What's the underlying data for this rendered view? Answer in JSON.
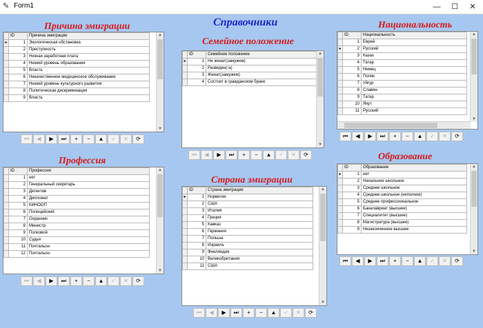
{
  "window": {
    "title": "Form1",
    "minimize": "—",
    "maximize": "☐",
    "close": "✕"
  },
  "headings": {
    "main": "Справочники",
    "reasons": "Причина эмиграции",
    "family": "Семейное положение",
    "nationality": "Национальность",
    "profession": "Профессия",
    "countries": "Страна эмиграции",
    "education": "Образование"
  },
  "icons": {
    "first": "⏮",
    "prev": "◀",
    "next": "▶",
    "last": "⏭",
    "insert": "+",
    "delete": "−",
    "edit": "▲",
    "post": "✓",
    "cancel": "✕",
    "refresh": "⟳"
  },
  "grids": {
    "reasons": {
      "col_id": "ID",
      "col_name": "Причина эмиграции",
      "rows": [
        {
          "id": "1",
          "name": "Экологическая обстановка"
        },
        {
          "id": "2",
          "name": "Преступность"
        },
        {
          "id": "3",
          "name": "Низкая заработная плата"
        },
        {
          "id": "4",
          "name": "Низкий уровень образования"
        },
        {
          "id": "5",
          "name": "Власть"
        },
        {
          "id": "6",
          "name": "Некачественное медицинское обслуживание"
        },
        {
          "id": "7",
          "name": "Низкий уровень культурного развития"
        },
        {
          "id": "8",
          "name": "Политическая дискриминация"
        },
        {
          "id": "9",
          "name": "Власть"
        }
      ]
    },
    "family": {
      "col_id": "ID",
      "col_name": "Семейное положение",
      "rows": [
        {
          "id": "1",
          "name": "Не женат(замужем)"
        },
        {
          "id": "2",
          "name": "Разведен(-а)"
        },
        {
          "id": "3",
          "name": "Женат(замужем)"
        },
        {
          "id": "4",
          "name": "Состоит в гражданском браке"
        }
      ]
    },
    "nationality": {
      "col_id": "ID",
      "col_name": "Национальность",
      "rows": [
        {
          "id": "1",
          "name": "Еврей"
        },
        {
          "id": "2",
          "name": "Русский"
        },
        {
          "id": "3",
          "name": "Казах"
        },
        {
          "id": "4",
          "name": "Татар"
        },
        {
          "id": "5",
          "name": "Немец"
        },
        {
          "id": "6",
          "name": "Поляк"
        },
        {
          "id": "7",
          "name": "Уйгур"
        },
        {
          "id": "8",
          "name": "Славян"
        },
        {
          "id": "9",
          "name": "Татар"
        },
        {
          "id": "10",
          "name": "Якут"
        },
        {
          "id": "11",
          "name": "Русский"
        }
      ]
    },
    "profession": {
      "col_id": "ID",
      "col_name": "Профессия",
      "rows": [
        {
          "id": "1",
          "name": "нет"
        },
        {
          "id": "2",
          "name": "Генеральный секретарь"
        },
        {
          "id": "3",
          "name": "Детектив"
        },
        {
          "id": "4",
          "name": "Дипломат"
        },
        {
          "id": "5",
          "name": "КИНООП"
        },
        {
          "id": "6",
          "name": "Полицейский"
        },
        {
          "id": "7",
          "name": "Охранник"
        },
        {
          "id": "8",
          "name": "Министр"
        },
        {
          "id": "9",
          "name": "Полковой"
        },
        {
          "id": "10",
          "name": "Судья"
        },
        {
          "id": "11",
          "name": "Почтальон"
        },
        {
          "id": "12",
          "name": "Почтальон"
        }
      ]
    },
    "countries": {
      "col_id": "ID",
      "col_name": "Страна эмиграции",
      "rows": [
        {
          "id": "1",
          "name": "Норвегия"
        },
        {
          "id": "2",
          "name": "США"
        },
        {
          "id": "3",
          "name": "Италия"
        },
        {
          "id": "4",
          "name": "Греция"
        },
        {
          "id": "5",
          "name": "Кавказ"
        },
        {
          "id": "6",
          "name": "Германия"
        },
        {
          "id": "7",
          "name": "Польша"
        },
        {
          "id": "8",
          "name": "Израиль"
        },
        {
          "id": "9",
          "name": "Финляндия"
        },
        {
          "id": "10",
          "name": "Великобритания"
        },
        {
          "id": "11",
          "name": "США"
        }
      ]
    },
    "education": {
      "col_id": "ID",
      "col_name": "Образование",
      "rows": [
        {
          "id": "1",
          "name": "нет"
        },
        {
          "id": "2",
          "name": "Начальное школьное"
        },
        {
          "id": "3",
          "name": "Среднее школьное"
        },
        {
          "id": "4",
          "name": "Среднее школьное (неполное)"
        },
        {
          "id": "5",
          "name": "Среднее профессиональное"
        },
        {
          "id": "6",
          "name": "Бакалавриат (высшее)"
        },
        {
          "id": "7",
          "name": "Специалитет (высшее)"
        },
        {
          "id": "8",
          "name": "Магистратура (высшее)"
        },
        {
          "id": "9",
          "name": "Незаконченное высшее"
        }
      ]
    }
  }
}
